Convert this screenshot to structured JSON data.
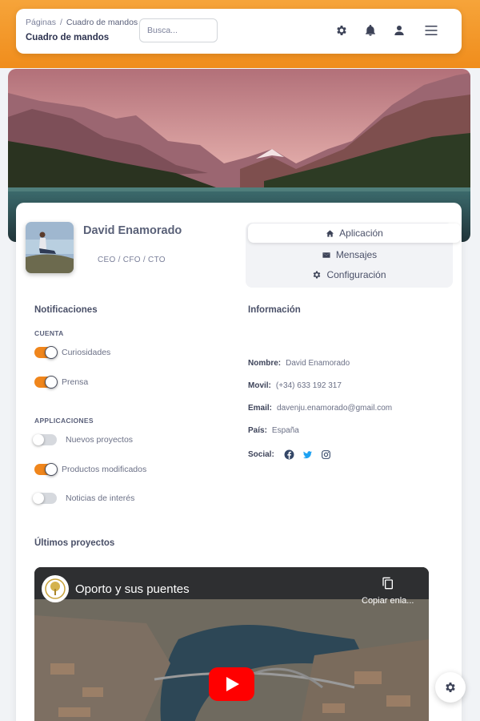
{
  "breadcrumb": {
    "root": "Páginas",
    "separator": "/",
    "current": "Cuadro de mandos"
  },
  "header": {
    "title": "Cuadro de mandos"
  },
  "search": {
    "placeholder": "Busca..."
  },
  "profile": {
    "name": "David Enamorado",
    "role": "CEO / CFO / CTO"
  },
  "tabs": [
    {
      "label": "Aplicación",
      "icon": "home-icon",
      "active": true
    },
    {
      "label": "Mensajes",
      "icon": "envelope-icon",
      "active": false
    },
    {
      "label": "Configuración",
      "icon": "gear-icon",
      "active": false
    }
  ],
  "notifications": {
    "title": "Notificaciones",
    "account_heading": "CUENTA",
    "account": [
      {
        "label": "Curiosidades",
        "on": true
      },
      {
        "label": "Prensa",
        "on": true
      }
    ],
    "apps_heading": "APPLICACIONES",
    "apps": [
      {
        "label": "Nuevos proyectos",
        "on": false
      },
      {
        "label": "Productos modificados",
        "on": true
      },
      {
        "label": "Noticias de interés",
        "on": false
      }
    ]
  },
  "info": {
    "title": "Información",
    "rows": [
      {
        "key": "Nombre:",
        "value": "David Enamorado"
      },
      {
        "key": "Movil:",
        "value": "(+34) 633 192 317"
      },
      {
        "key": "Email:",
        "value": "davenju.enamorado@gmail.com"
      },
      {
        "key": "País:",
        "value": "España"
      }
    ],
    "social_label": "Social:",
    "social": [
      "facebook-icon",
      "twitter-icon",
      "instagram-icon"
    ]
  },
  "projects": {
    "title": "Últimos proyectos",
    "video_title": "Oporto y sus puentes",
    "copy_label": "Copiar enla..."
  },
  "colors": {
    "accent": "#f0861c",
    "text": "#344767",
    "youtube_red": "#ff0000"
  }
}
